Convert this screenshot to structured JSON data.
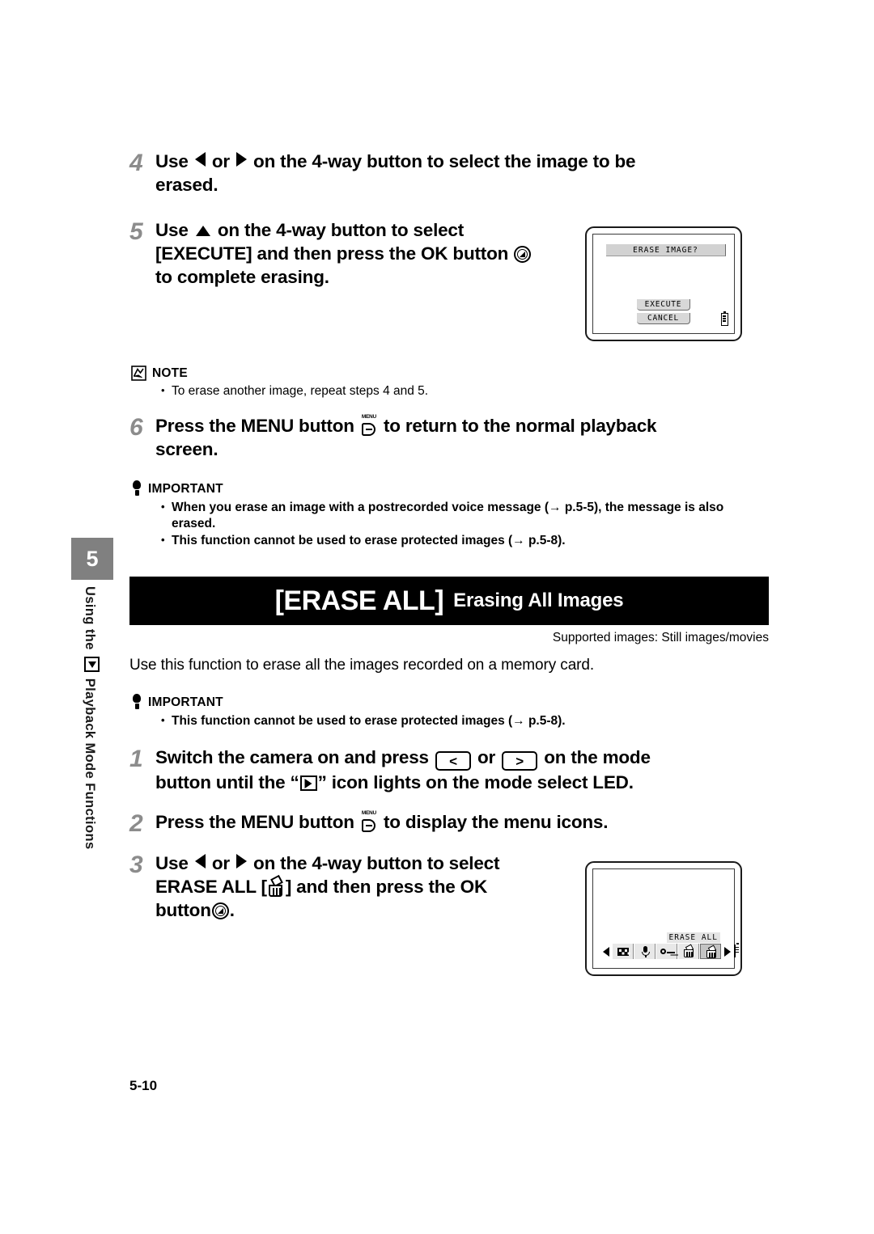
{
  "sidebar": {
    "chapter_number": "5",
    "vertical_label_before": "Using the",
    "vertical_icon": "playback-mode-icon",
    "vertical_label_after": "Playback Mode Functions"
  },
  "steps": [
    {
      "number": "4",
      "text_parts": [
        "Use ",
        " or ",
        " on the 4-way button to select the image to be erased."
      ]
    },
    {
      "number": "5",
      "text_parts": [
        "Use ",
        " on the 4-way button to select [EXECUTE] and then press the OK button ",
        " to complete erasing."
      ]
    },
    {
      "number": "6",
      "text_parts": [
        "Press the MENU button ",
        " to return to the normal playback screen."
      ]
    },
    {
      "number": "1",
      "text_parts": [
        "Switch the camera on and press ",
        " or ",
        " on the mode button until the “",
        "” icon lights on the mode select LED."
      ]
    },
    {
      "number": "2",
      "text_parts": [
        "Press the MENU button ",
        " to display the menu icons."
      ]
    },
    {
      "number": "3",
      "text_parts": [
        "Use ",
        " or ",
        " on the 4-way button to select ERASE ALL [",
        "] and then press the OK button ",
        "."
      ]
    }
  ],
  "step4": {
    "num": "4",
    "a": "Use",
    "b": "or",
    "c": "on the 4-way button to select the image to be",
    "d": "erased."
  },
  "step5": {
    "num": "5",
    "a": "Use",
    "b": "on the 4-way button to select",
    "c": "[EXECUTE] and then press the OK button",
    "d": "to complete erasing."
  },
  "step6": {
    "num": "6",
    "a": "Press the MENU button",
    "b": "to return to the normal playback",
    "c": "screen."
  },
  "step1": {
    "num": "1",
    "a": "Switch the camera on and press",
    "b": "or",
    "c": "on the mode",
    "d": "button until the “",
    "e": "” icon lights on the mode select LED.",
    "key_left": "<",
    "key_right": ">"
  },
  "step2": {
    "num": "2",
    "a": "Press the MENU button",
    "b": "to display the menu icons."
  },
  "step3": {
    "num": "3",
    "a": "Use",
    "b": "or",
    "c": "on the 4-way button to select",
    "d": "ERASE ALL [",
    "e": "] and then press the OK",
    "f": "button",
    "g": "."
  },
  "note": {
    "heading": "NOTE",
    "items": [
      "To erase another image, repeat steps 4 and 5."
    ]
  },
  "important_1": {
    "heading": "IMPORTANT",
    "items": [
      "When you erase an image with a postrecorded voice message (→ p.5-5), the message is also erased.",
      "This function cannot be used to erase protected images (→ p.5-8)."
    ]
  },
  "important_2": {
    "heading": "IMPORTANT",
    "items": [
      "This function cannot be used to erase protected images (→ p.5-8)."
    ]
  },
  "banner": {
    "main_title": "[ERASE ALL]",
    "subtitle": "Erasing All Images",
    "supported_images": "Supported images: Still images/movies",
    "intro": "Use this function to erase all the images recorded on a memory card.",
    "background_color": "#000000",
    "text_color": "#ffffff"
  },
  "lcd_erase_image": {
    "title": "ERASE IMAGE?",
    "buttons": [
      "EXECUTE",
      "CANCEL"
    ],
    "battery_icon": "battery-icon"
  },
  "lcd_erase_all": {
    "menu_label": "ERASE ALL",
    "icons": [
      {
        "name": "thumbnail-icon",
        "selected": false
      },
      {
        "name": "voice-memo-icon",
        "selected": false
      },
      {
        "name": "protect-key-icon",
        "selected": false
      },
      {
        "name": "erase-icon",
        "selected": false
      },
      {
        "name": "erase-all-icon",
        "selected": true
      }
    ],
    "left_arrow": "arrow-left-icon",
    "right_arrow": "arrow-right-icon",
    "battery_icon": "battery-icon"
  },
  "footer": {
    "page_number": "5-10"
  }
}
